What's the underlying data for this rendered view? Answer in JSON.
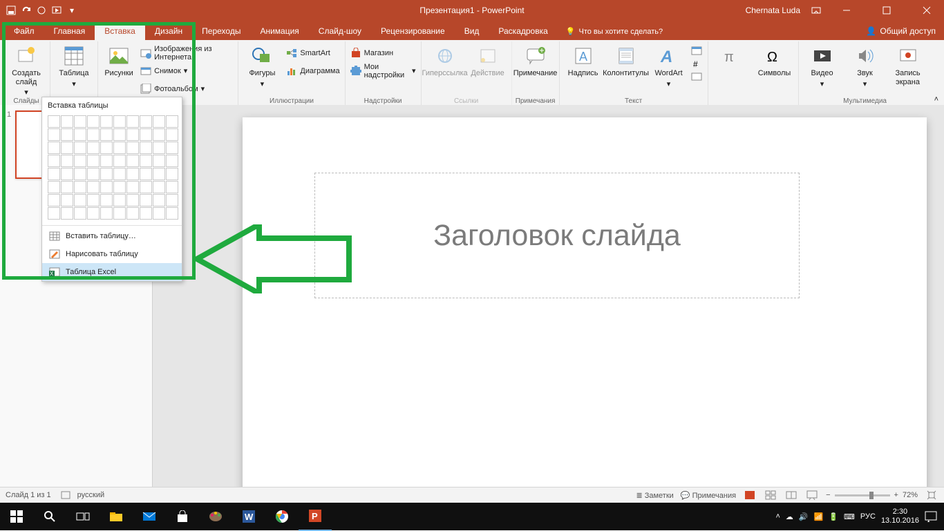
{
  "titlebar": {
    "title": "Презентация1 - PowerPoint",
    "user": "Chernata Luda"
  },
  "tabs": {
    "file": "Файл",
    "home": "Главная",
    "insert": "Вставка",
    "design": "Дизайн",
    "transitions": "Переходы",
    "animations": "Анимация",
    "slideshow": "Слайд-шоу",
    "review": "Рецензирование",
    "view": "Вид",
    "storyboard": "Раскадровка",
    "tellme": "Что вы хотите сделать?",
    "share": "Общий доступ"
  },
  "ribbon": {
    "slides": {
      "new_slide": "Создать слайд",
      "group": "Слайды"
    },
    "tables": {
      "table": "Таблица"
    },
    "images": {
      "pictures": "Рисунки",
      "online": "Изображения из Интернета",
      "screenshot": "Снимок",
      "album": "Фотоальбом"
    },
    "illustrations": {
      "group": "Иллюстрации",
      "shapes": "Фигуры",
      "smartart": "SmartArt",
      "chart": "Диаграмма"
    },
    "addins": {
      "group": "Надстройки",
      "store": "Магазин",
      "myaddins": "Мои надстройки"
    },
    "links": {
      "group": "Ссылки",
      "hyperlink": "Гиперссылка",
      "action": "Действие"
    },
    "comments": {
      "group": "Примечания",
      "comment": "Примечание"
    },
    "text": {
      "group": "Текст",
      "textbox": "Надпись",
      "header": "Колонтитулы",
      "wordart": "WordArt"
    },
    "symbols": {
      "group": "Символы"
    },
    "media": {
      "group": "Мультимедиа",
      "video": "Видео",
      "audio": "Звук",
      "record": "Запись экрана"
    }
  },
  "dropdown": {
    "title": "Вставка таблицы",
    "insert": "Вставить таблицу…",
    "draw": "Нарисовать таблицу",
    "excel": "Таблица Excel"
  },
  "slide": {
    "title_placeholder": "Заголовок слайда"
  },
  "status": {
    "slide": "Слайд 1 из 1",
    "lang": "русский",
    "notes": "Заметки",
    "comments": "Примечания",
    "zoom": "72%"
  },
  "thumb": {
    "num": "1"
  },
  "taskbar": {
    "lang": "РУС",
    "time": "2:30",
    "date": "13.10.2016"
  }
}
